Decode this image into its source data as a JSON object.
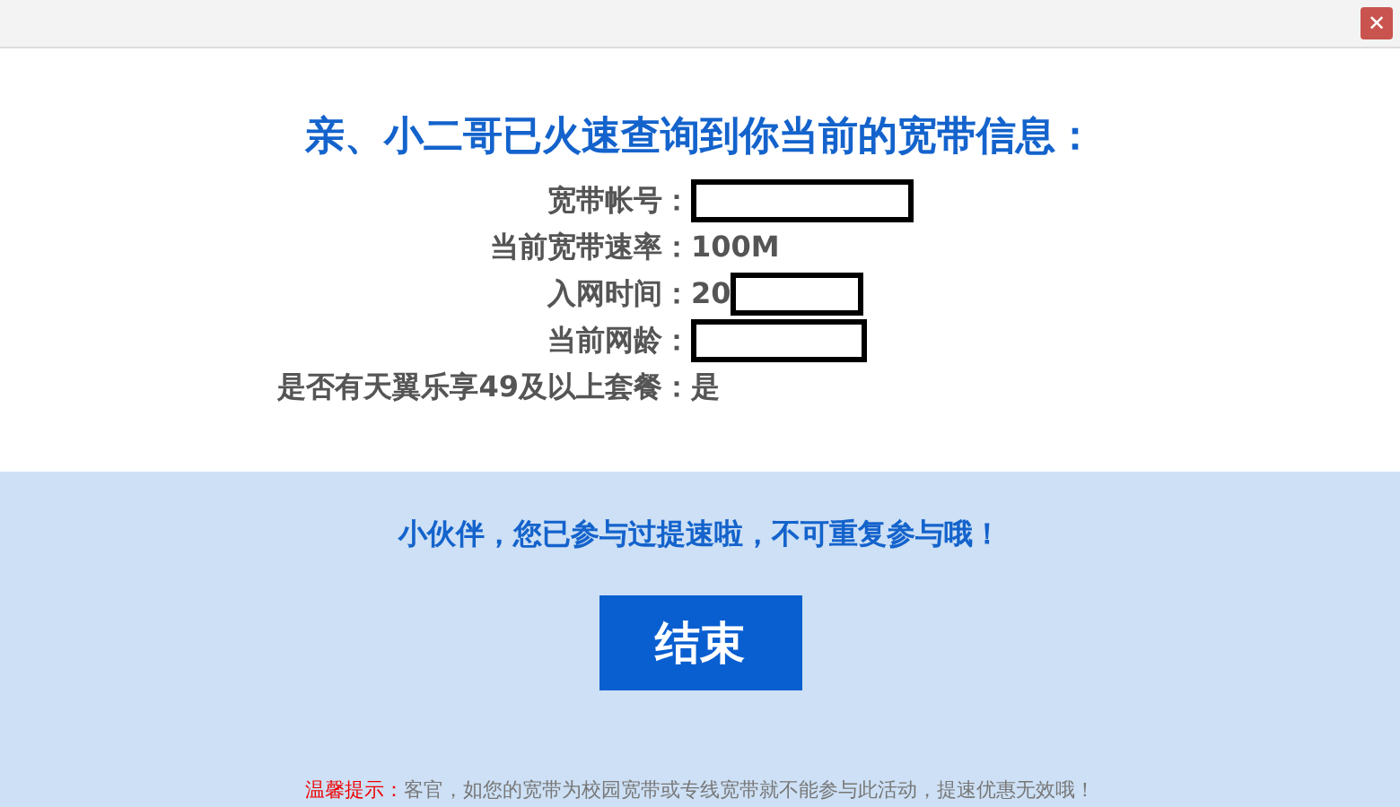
{
  "close_button": {
    "label": "✕"
  },
  "title": "亲、小二哥已火速查询到你当前的宽带信息：",
  "info_rows": [
    {
      "label": "宽带帐号：",
      "value": "",
      "redacted": true
    },
    {
      "label": "当前宽带速率：",
      "value": "100M",
      "redacted": false
    },
    {
      "label": "入网时间：",
      "value": "20",
      "redacted": true
    },
    {
      "label": "当前网龄：",
      "value": "",
      "redacted": true
    },
    {
      "label": "是否有天翼乐享49及以上套餐：",
      "value": "是",
      "redacted": false
    }
  ],
  "message": "小伙伴，您已参与过提速啦，不可重复参与哦！",
  "end_button": {
    "label": "结束"
  },
  "tip": {
    "label": "温馨提示：",
    "text": "客官，如您的宽带为校园宽带或专线宽带就不能参与此活动，提速优惠无效哦！"
  }
}
